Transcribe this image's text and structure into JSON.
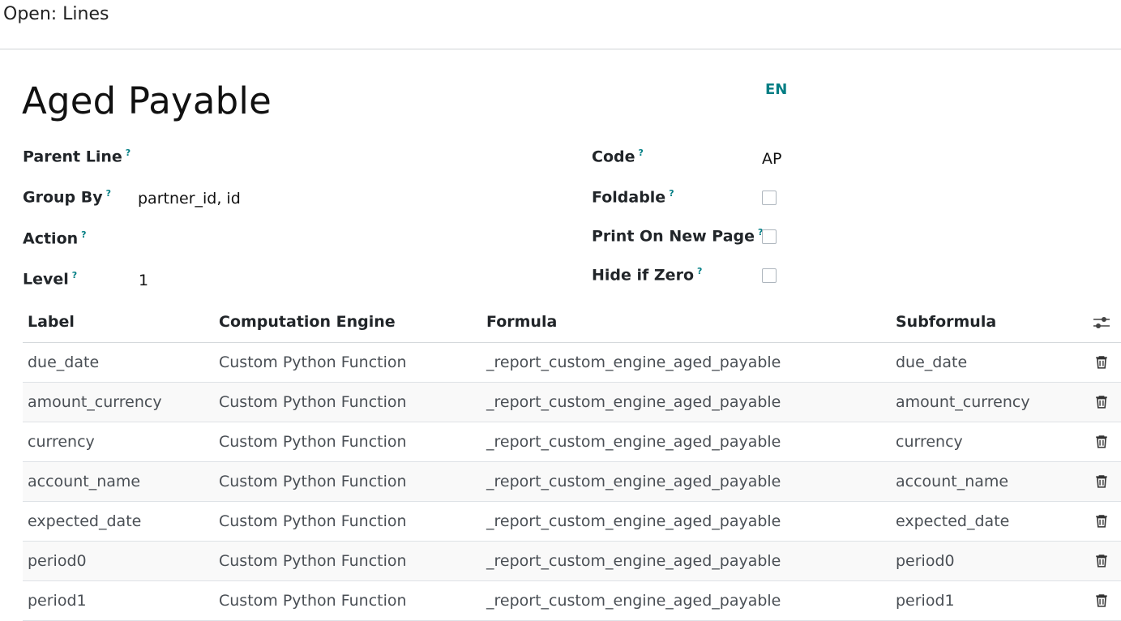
{
  "dialog": {
    "title": "Open: Lines"
  },
  "record": {
    "name": "Aged Payable",
    "lang": "EN"
  },
  "fields": {
    "parent_line": {
      "label": "Parent Line",
      "help": "?",
      "value": ""
    },
    "group_by": {
      "label": "Group By",
      "help": "?",
      "value": "partner_id, id"
    },
    "action": {
      "label": "Action",
      "help": "?",
      "value": ""
    },
    "level": {
      "label": "Level",
      "help": "?",
      "value": "1"
    },
    "code": {
      "label": "Code",
      "help": "?",
      "value": "AP"
    },
    "foldable": {
      "label": "Foldable",
      "help": "?",
      "checked": false
    },
    "print_new_page": {
      "label": "Print On New Page",
      "help": "?",
      "checked": false
    },
    "hide_if_zero": {
      "label": "Hide if Zero",
      "help": "?",
      "checked": false
    }
  },
  "table": {
    "columns": {
      "label": "Label",
      "engine": "Computation Engine",
      "formula": "Formula",
      "subformula": "Subformula"
    },
    "settings_icon": "sliders-icon",
    "delete_icon": "trash-icon",
    "rows": [
      {
        "label": "due_date",
        "engine": "Custom Python Function",
        "formula": "_report_custom_engine_aged_payable",
        "subformula": "due_date"
      },
      {
        "label": "amount_currency",
        "engine": "Custom Python Function",
        "formula": "_report_custom_engine_aged_payable",
        "subformula": "amount_currency"
      },
      {
        "label": "currency",
        "engine": "Custom Python Function",
        "formula": "_report_custom_engine_aged_payable",
        "subformula": "currency"
      },
      {
        "label": "account_name",
        "engine": "Custom Python Function",
        "formula": "_report_custom_engine_aged_payable",
        "subformula": "account_name"
      },
      {
        "label": "expected_date",
        "engine": "Custom Python Function",
        "formula": "_report_custom_engine_aged_payable",
        "subformula": "expected_date"
      },
      {
        "label": "period0",
        "engine": "Custom Python Function",
        "formula": "_report_custom_engine_aged_payable",
        "subformula": "period0"
      },
      {
        "label": "period1",
        "engine": "Custom Python Function",
        "formula": "_report_custom_engine_aged_payable",
        "subformula": "period1"
      }
    ]
  },
  "colors": {
    "accent": "#017e84"
  }
}
